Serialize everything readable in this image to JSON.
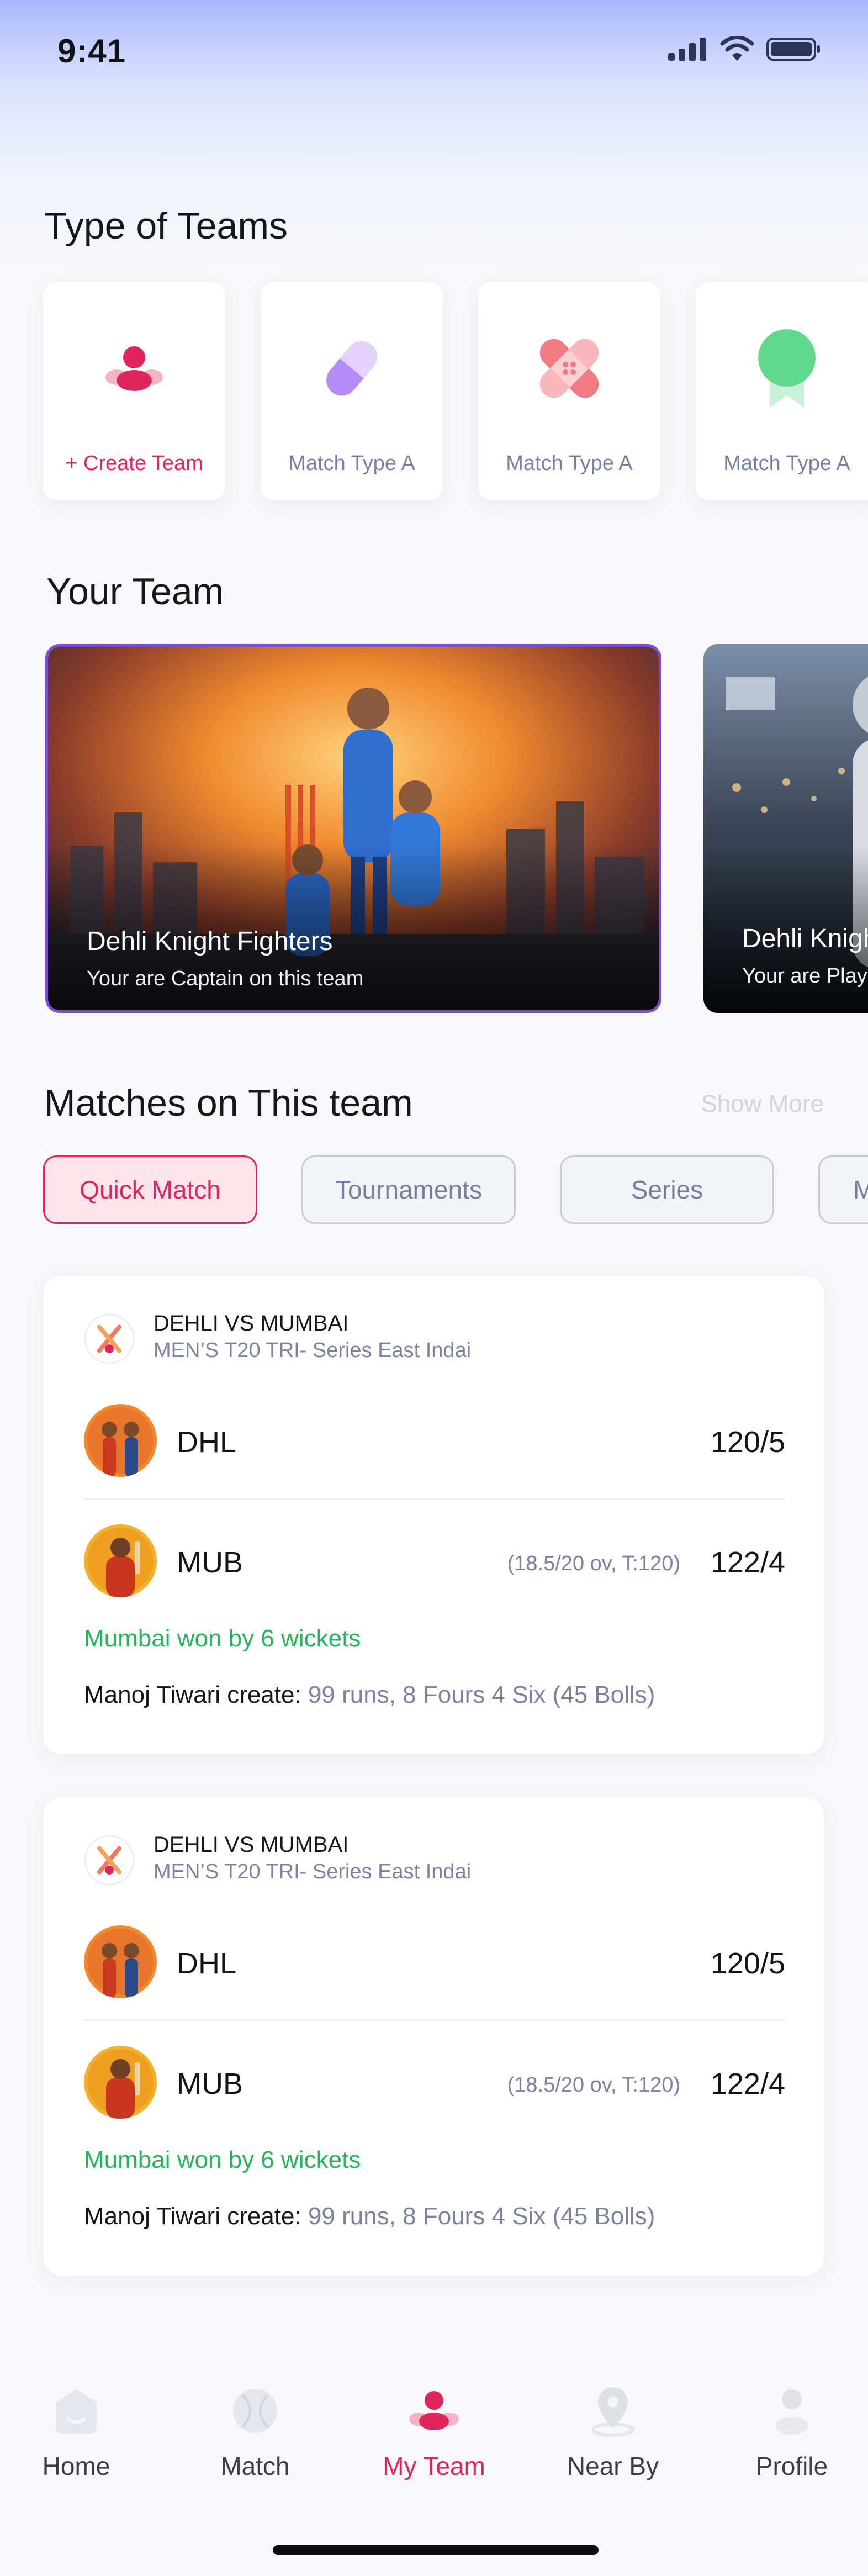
{
  "status": {
    "time": "9:41"
  },
  "type_section": {
    "title": "Type of Teams",
    "cards": [
      {
        "label": "+ Create Team",
        "icon": "team-icon"
      },
      {
        "label": "Match Type A",
        "icon": "capsule-icon"
      },
      {
        "label": "Match Type A",
        "icon": "bandage-icon"
      },
      {
        "label": "Match Type A",
        "icon": "ribbon-badge-icon"
      }
    ]
  },
  "team_section": {
    "title": "Your Team",
    "teams": [
      {
        "name": "Dehli Knight Fighters",
        "role": "Your are Captain on this team"
      },
      {
        "name": "Dehli Knight Fighters",
        "role": "Your are Player on this team"
      }
    ]
  },
  "matches_section": {
    "title": "Matches on This team",
    "show_more": "Show More",
    "tabs": [
      "Quick Match",
      "Tournaments",
      "Series",
      "Matches"
    ],
    "matches": [
      {
        "title": "DEHLI VS MUMBAI",
        "subtitle": "MEN’S T20 TRI- Series East Indai",
        "team1": {
          "abbr": "DHL",
          "score": "120/5"
        },
        "team2": {
          "abbr": "MUB",
          "overs": "(18.5/20 ov, T:120)",
          "score": "122/4"
        },
        "result": "Mumbai won by 6 wickets",
        "performer": "Manoj Tiwari create:",
        "performance": "99 runs, 8 Fours 4 Six (45 Bolls)"
      },
      {
        "title": "DEHLI VS MUMBAI",
        "subtitle": "MEN’S T20 TRI- Series East Indai",
        "team1": {
          "abbr": "DHL",
          "score": "120/5"
        },
        "team2": {
          "abbr": "MUB",
          "overs": "(18.5/20 ov, T:120)",
          "score": "122/4"
        },
        "result": "Mumbai won by 6 wickets",
        "performer": "Manoj Tiwari create:",
        "performance": "99 runs, 8 Fours 4 Six (45 Bolls)"
      }
    ]
  },
  "nav": {
    "items": [
      {
        "label": "Home",
        "icon": "home-icon"
      },
      {
        "label": "Match",
        "icon": "cricket-ball-icon"
      },
      {
        "label": "My Team",
        "icon": "team-icon",
        "active": true
      },
      {
        "label": "Near By",
        "icon": "location-pin-icon"
      },
      {
        "label": "Profile",
        "icon": "profile-icon"
      }
    ]
  },
  "colors": {
    "accent": "#e0245e",
    "active_border": "#7b4bdc",
    "result_green": "#22b55a",
    "muted": "#7b82a0"
  }
}
